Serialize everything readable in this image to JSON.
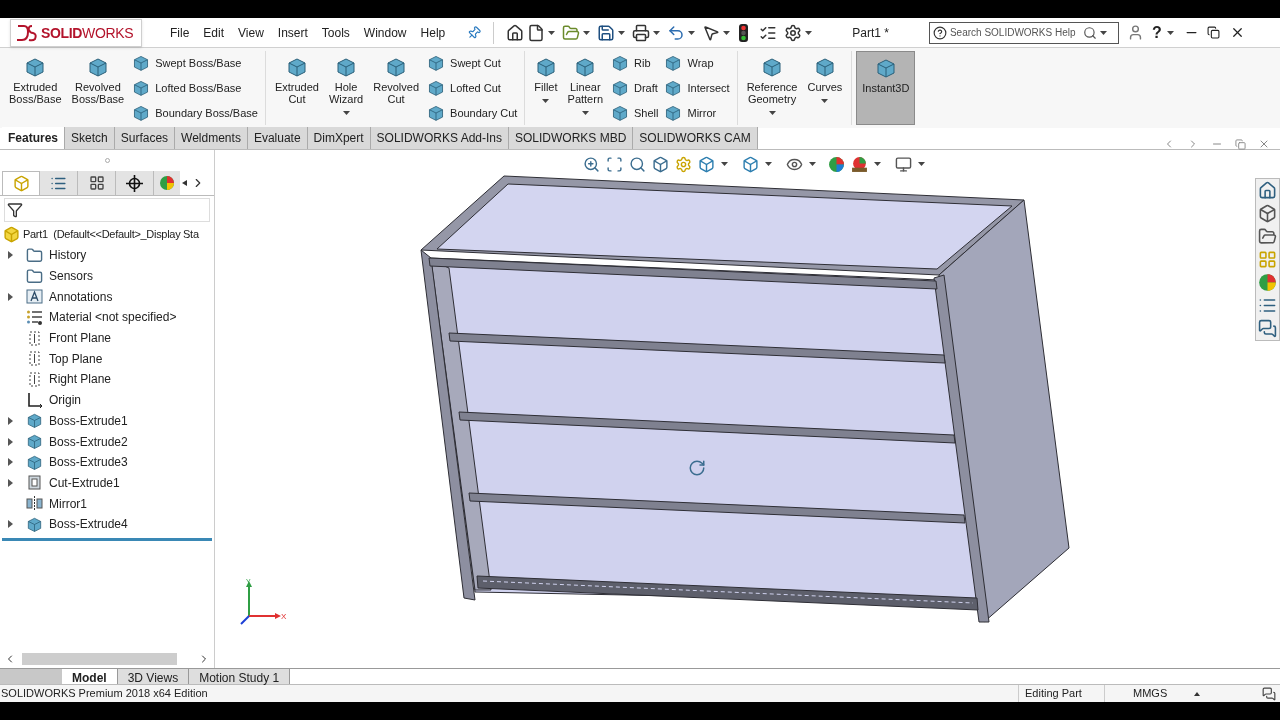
{
  "logo": "**SOLID**WORKS",
  "menu": [
    "File",
    "Edit",
    "View",
    "Insert",
    "Tools",
    "Window",
    "Help"
  ],
  "document_title": "Part1 *",
  "search": {
    "placeholder": "Search SOLIDWORKS Help"
  },
  "help_glyph": "?",
  "ribbon": [
    {
      "items": [
        {
          "kind": "large",
          "label": "Extruded\nBoss/Base",
          "menu": false,
          "pressed": false
        },
        {
          "kind": "large",
          "label": "Revolved\nBoss/Base",
          "menu": false,
          "pressed": false
        },
        {
          "kind": "stack",
          "entries": [
            "Swept Boss/Base",
            "Lofted Boss/Base",
            "Boundary Boss/Base"
          ]
        }
      ]
    },
    {
      "items": [
        {
          "kind": "large",
          "label": "Extruded\nCut",
          "menu": false,
          "pressed": false
        },
        {
          "kind": "large",
          "label": "Hole\nWizard",
          "menu": true,
          "pressed": false
        },
        {
          "kind": "large",
          "label": "Revolved\nCut",
          "menu": false,
          "pressed": false
        },
        {
          "kind": "stack",
          "entries": [
            "Swept Cut",
            "Lofted Cut",
            "Boundary Cut"
          ]
        }
      ]
    },
    {
      "items": [
        {
          "kind": "large",
          "label": "Fillet",
          "menu": true,
          "pressed": false
        },
        {
          "kind": "large",
          "label": "Linear\nPattern",
          "menu": true,
          "pressed": false
        },
        {
          "kind": "stack",
          "entries": [
            "Rib",
            "Draft",
            "Shell"
          ]
        },
        {
          "kind": "stack",
          "entries": [
            "Wrap",
            "Intersect",
            "Mirror"
          ]
        }
      ]
    },
    {
      "items": [
        {
          "kind": "large",
          "label": "Reference\nGeometry",
          "menu": true,
          "pressed": false
        },
        {
          "kind": "large",
          "label": "Curves",
          "menu": true,
          "pressed": false
        }
      ]
    },
    {
      "items": [
        {
          "kind": "large",
          "label": "Instant3D",
          "menu": false,
          "pressed": true
        }
      ]
    }
  ],
  "tabs": [
    {
      "label": "Features",
      "selected": true
    },
    {
      "label": "Sketch",
      "selected": false
    },
    {
      "label": "Surfaces",
      "selected": false
    },
    {
      "label": "Weldments",
      "selected": false
    },
    {
      "label": "Evaluate",
      "selected": false
    },
    {
      "label": "DimXpert",
      "selected": false
    },
    {
      "label": "SOLIDWORKS Add-Ins",
      "selected": false
    },
    {
      "label": "SOLIDWORKS MBD",
      "selected": false
    },
    {
      "label": "SOLIDWORKS CAM",
      "selected": false
    }
  ],
  "tree": {
    "root": "Part1  (Default<<Default>_Display Sta",
    "children": [
      {
        "label": "History",
        "kind": "folder",
        "expandable": true
      },
      {
        "label": "Sensors",
        "kind": "folder",
        "expandable": false
      },
      {
        "label": "Annotations",
        "kind": "annotations",
        "expandable": true
      },
      {
        "label": "Material <not specified>",
        "kind": "material",
        "expandable": false
      },
      {
        "label": "Front Plane",
        "kind": "plane",
        "expandable": false
      },
      {
        "label": "Top Plane",
        "kind": "plane",
        "expandable": false
      },
      {
        "label": "Right Plane",
        "kind": "plane",
        "expandable": false
      },
      {
        "label": "Origin",
        "kind": "origin",
        "expandable": false
      },
      {
        "label": "Boss-Extrude1",
        "kind": "feature",
        "expandable": true
      },
      {
        "label": "Boss-Extrude2",
        "kind": "feature",
        "expandable": true
      },
      {
        "label": "Boss-Extrude3",
        "kind": "feature",
        "expandable": true
      },
      {
        "label": "Cut-Extrude1",
        "kind": "cut",
        "expandable": true
      },
      {
        "label": "Mirror1",
        "kind": "mirror",
        "expandable": false
      },
      {
        "label": "Boss-Extrude4",
        "kind": "feature",
        "expandable": true
      }
    ]
  },
  "triad": {
    "x": "X",
    "y": "Y"
  },
  "bottom_tabs": [
    {
      "label": "Model",
      "selected": true
    },
    {
      "label": "3D Views",
      "selected": false
    },
    {
      "label": "Motion Study 1",
      "selected": false
    }
  ],
  "status_bar": {
    "edition": "SOLIDWORKS Premium 2018 x64 Edition",
    "mode": "Editing Part",
    "units": "MMGS"
  }
}
